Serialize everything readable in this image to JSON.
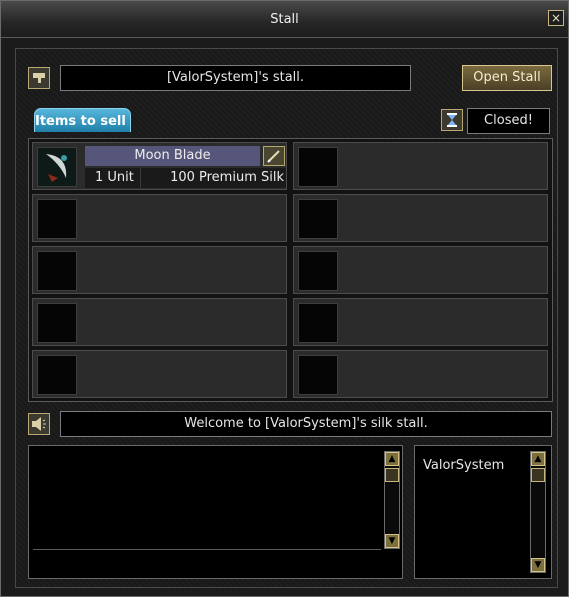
{
  "window": {
    "title": "Stall",
    "close_label": "×"
  },
  "header": {
    "stall_name": "[ValorSystem]'s stall.",
    "open_button": "Open Stall",
    "status": "Closed!"
  },
  "tabs": {
    "items_to_sell": "Items to sell"
  },
  "slots": [
    {
      "name": "Moon Blade",
      "quantity": "1 Unit",
      "price": "100 Premium Silk"
    }
  ],
  "message": {
    "text": "Welcome to [ValorSystem]'s silk stall."
  },
  "visitors": [
    "ValorSystem"
  ],
  "colors": {
    "accent_tab": "#2b9ac6",
    "button_gold": "#d8c78e",
    "item_name_bg": "#56567a"
  },
  "icons": {
    "stall_name": "pencil-note-icon",
    "status": "hourglass-icon",
    "message": "speaker-icon",
    "edit": "edit-pencil-icon",
    "close": "close-icon"
  }
}
